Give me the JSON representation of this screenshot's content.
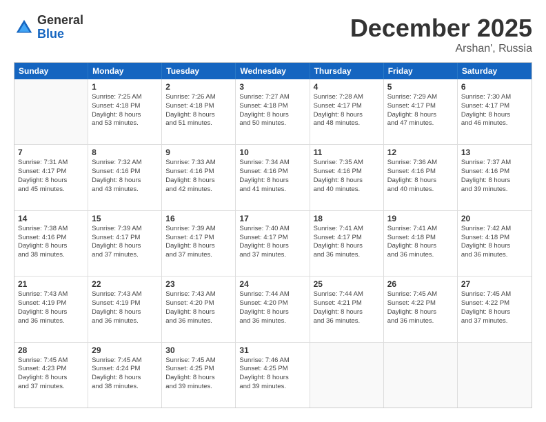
{
  "logo": {
    "general": "General",
    "blue": "Blue"
  },
  "title": "December 2025",
  "location": "Arshan', Russia",
  "days": [
    "Sunday",
    "Monday",
    "Tuesday",
    "Wednesday",
    "Thursday",
    "Friday",
    "Saturday"
  ],
  "rows": [
    [
      {
        "day": "",
        "content": ""
      },
      {
        "day": "1",
        "content": "Sunrise: 7:25 AM\nSunset: 4:18 PM\nDaylight: 8 hours\nand 53 minutes."
      },
      {
        "day": "2",
        "content": "Sunrise: 7:26 AM\nSunset: 4:18 PM\nDaylight: 8 hours\nand 51 minutes."
      },
      {
        "day": "3",
        "content": "Sunrise: 7:27 AM\nSunset: 4:18 PM\nDaylight: 8 hours\nand 50 minutes."
      },
      {
        "day": "4",
        "content": "Sunrise: 7:28 AM\nSunset: 4:17 PM\nDaylight: 8 hours\nand 48 minutes."
      },
      {
        "day": "5",
        "content": "Sunrise: 7:29 AM\nSunset: 4:17 PM\nDaylight: 8 hours\nand 47 minutes."
      },
      {
        "day": "6",
        "content": "Sunrise: 7:30 AM\nSunset: 4:17 PM\nDaylight: 8 hours\nand 46 minutes."
      }
    ],
    [
      {
        "day": "7",
        "content": "Sunrise: 7:31 AM\nSunset: 4:17 PM\nDaylight: 8 hours\nand 45 minutes."
      },
      {
        "day": "8",
        "content": "Sunrise: 7:32 AM\nSunset: 4:16 PM\nDaylight: 8 hours\nand 43 minutes."
      },
      {
        "day": "9",
        "content": "Sunrise: 7:33 AM\nSunset: 4:16 PM\nDaylight: 8 hours\nand 42 minutes."
      },
      {
        "day": "10",
        "content": "Sunrise: 7:34 AM\nSunset: 4:16 PM\nDaylight: 8 hours\nand 41 minutes."
      },
      {
        "day": "11",
        "content": "Sunrise: 7:35 AM\nSunset: 4:16 PM\nDaylight: 8 hours\nand 40 minutes."
      },
      {
        "day": "12",
        "content": "Sunrise: 7:36 AM\nSunset: 4:16 PM\nDaylight: 8 hours\nand 40 minutes."
      },
      {
        "day": "13",
        "content": "Sunrise: 7:37 AM\nSunset: 4:16 PM\nDaylight: 8 hours\nand 39 minutes."
      }
    ],
    [
      {
        "day": "14",
        "content": "Sunrise: 7:38 AM\nSunset: 4:16 PM\nDaylight: 8 hours\nand 38 minutes."
      },
      {
        "day": "15",
        "content": "Sunrise: 7:39 AM\nSunset: 4:17 PM\nDaylight: 8 hours\nand 37 minutes."
      },
      {
        "day": "16",
        "content": "Sunrise: 7:39 AM\nSunset: 4:17 PM\nDaylight: 8 hours\nand 37 minutes."
      },
      {
        "day": "17",
        "content": "Sunrise: 7:40 AM\nSunset: 4:17 PM\nDaylight: 8 hours\nand 37 minutes."
      },
      {
        "day": "18",
        "content": "Sunrise: 7:41 AM\nSunset: 4:17 PM\nDaylight: 8 hours\nand 36 minutes."
      },
      {
        "day": "19",
        "content": "Sunrise: 7:41 AM\nSunset: 4:18 PM\nDaylight: 8 hours\nand 36 minutes."
      },
      {
        "day": "20",
        "content": "Sunrise: 7:42 AM\nSunset: 4:18 PM\nDaylight: 8 hours\nand 36 minutes."
      }
    ],
    [
      {
        "day": "21",
        "content": "Sunrise: 7:43 AM\nSunset: 4:19 PM\nDaylight: 8 hours\nand 36 minutes."
      },
      {
        "day": "22",
        "content": "Sunrise: 7:43 AM\nSunset: 4:19 PM\nDaylight: 8 hours\nand 36 minutes."
      },
      {
        "day": "23",
        "content": "Sunrise: 7:43 AM\nSunset: 4:20 PM\nDaylight: 8 hours\nand 36 minutes."
      },
      {
        "day": "24",
        "content": "Sunrise: 7:44 AM\nSunset: 4:20 PM\nDaylight: 8 hours\nand 36 minutes."
      },
      {
        "day": "25",
        "content": "Sunrise: 7:44 AM\nSunset: 4:21 PM\nDaylight: 8 hours\nand 36 minutes."
      },
      {
        "day": "26",
        "content": "Sunrise: 7:45 AM\nSunset: 4:22 PM\nDaylight: 8 hours\nand 36 minutes."
      },
      {
        "day": "27",
        "content": "Sunrise: 7:45 AM\nSunset: 4:22 PM\nDaylight: 8 hours\nand 37 minutes."
      }
    ],
    [
      {
        "day": "28",
        "content": "Sunrise: 7:45 AM\nSunset: 4:23 PM\nDaylight: 8 hours\nand 37 minutes."
      },
      {
        "day": "29",
        "content": "Sunrise: 7:45 AM\nSunset: 4:24 PM\nDaylight: 8 hours\nand 38 minutes."
      },
      {
        "day": "30",
        "content": "Sunrise: 7:45 AM\nSunset: 4:25 PM\nDaylight: 8 hours\nand 39 minutes."
      },
      {
        "day": "31",
        "content": "Sunrise: 7:46 AM\nSunset: 4:25 PM\nDaylight: 8 hours\nand 39 minutes."
      },
      {
        "day": "",
        "content": ""
      },
      {
        "day": "",
        "content": ""
      },
      {
        "day": "",
        "content": ""
      }
    ]
  ]
}
